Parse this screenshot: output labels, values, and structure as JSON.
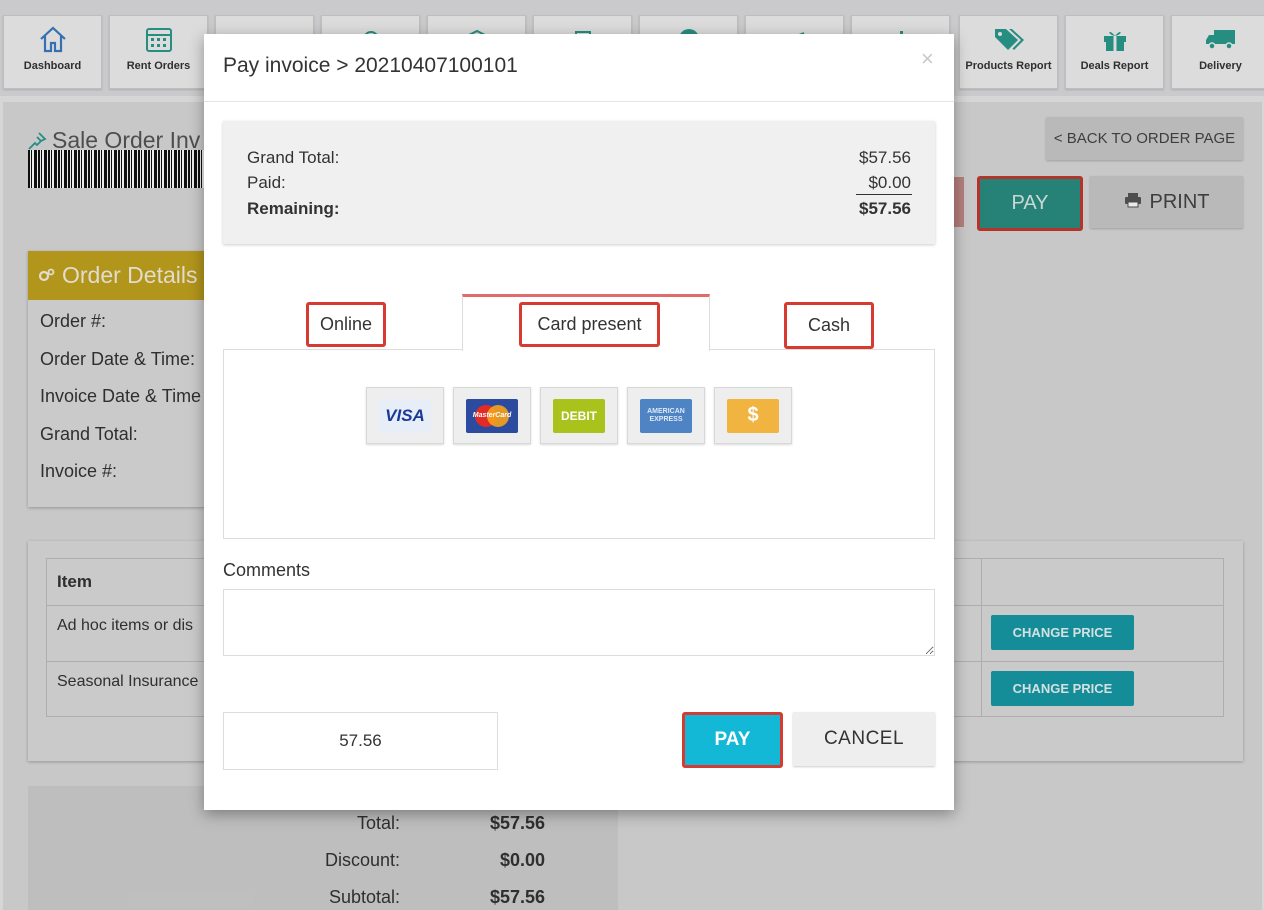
{
  "nav": {
    "tiles": [
      {
        "label": "Dashboard",
        "icon": "home-icon"
      },
      {
        "label": "Rent Orders",
        "icon": "calendar-icon"
      },
      {
        "label": "",
        "icon": "basket-icon"
      },
      {
        "label": "",
        "icon": "tag-icon"
      },
      {
        "label": "",
        "icon": "box-icon"
      },
      {
        "label": "",
        "icon": "clipboard-icon"
      },
      {
        "label": "",
        "icon": "pie-chart-icon"
      },
      {
        "label": "",
        "icon": "trend-icon"
      },
      {
        "label": "",
        "icon": "bar-chart-icon"
      },
      {
        "label": "Products Report",
        "icon": "tags-icon"
      },
      {
        "label": "Deals Report",
        "icon": "gift-icon"
      },
      {
        "label": "Delivery",
        "icon": "truck-icon"
      }
    ]
  },
  "page": {
    "title": "Sale Order Inv",
    "back_label": "< BACK TO ORDER PAGE",
    "pay_label": "PAY",
    "print_label": "PRINT",
    "order_details": {
      "header": "Order Details",
      "rows": [
        "Order #:",
        "Order Date & Time:",
        "Invoice Date & Time",
        "Grand Total:",
        "Invoice #:"
      ]
    },
    "items": {
      "header": "Item",
      "rows": [
        "Ad hoc items or dis",
        "Seasonal Insurance"
      ],
      "change_price_label": "CHANGE PRICE"
    },
    "totals": [
      {
        "label": "Total:",
        "value": "$57.56"
      },
      {
        "label": "Discount:",
        "value": "$0.00"
      },
      {
        "label": "Subtotal:",
        "value": "$57.56"
      }
    ]
  },
  "modal": {
    "title": "Pay invoice > 20210407100101",
    "close": "×",
    "summary": {
      "grand_total_label": "Grand Total:",
      "grand_total_value": "$57.56",
      "paid_label": "Paid:",
      "paid_value": "$0.00",
      "remaining_label": "Remaining:",
      "remaining_value": "$57.56"
    },
    "tabs": [
      {
        "label": "Online",
        "active": false
      },
      {
        "label": "Card present",
        "active": true
      },
      {
        "label": "Cash",
        "active": false
      }
    ],
    "cards": [
      {
        "name": "visa-card-icon",
        "text": "VISA",
        "bg": "#e8eef7",
        "color": "#1a3a9a"
      },
      {
        "name": "mastercard-icon",
        "text": "MasterCard",
        "bg": "#2d4b9e",
        "color": "#ffffff"
      },
      {
        "name": "debit-card-icon",
        "text": "DEBIT",
        "bg": "#a9c21c",
        "color": "#ffffff"
      },
      {
        "name": "amex-card-icon",
        "text": "AMERICAN EXPRESS",
        "bg": "#4e83c4",
        "color": "#dfeaf7"
      },
      {
        "name": "cash-dollar-icon",
        "text": "$",
        "bg": "#f2b441",
        "color": "#ffffff"
      }
    ],
    "comments_label": "Comments",
    "comments_value": "",
    "amount_value": "57.56",
    "pay_label": "PAY",
    "cancel_label": "CANCEL"
  },
  "colors": {
    "accent_teal": "#179aa5",
    "pay_cyan": "#13b8d6",
    "highlight_red": "#d63a30",
    "order_details_gold": "#c2a21e"
  }
}
